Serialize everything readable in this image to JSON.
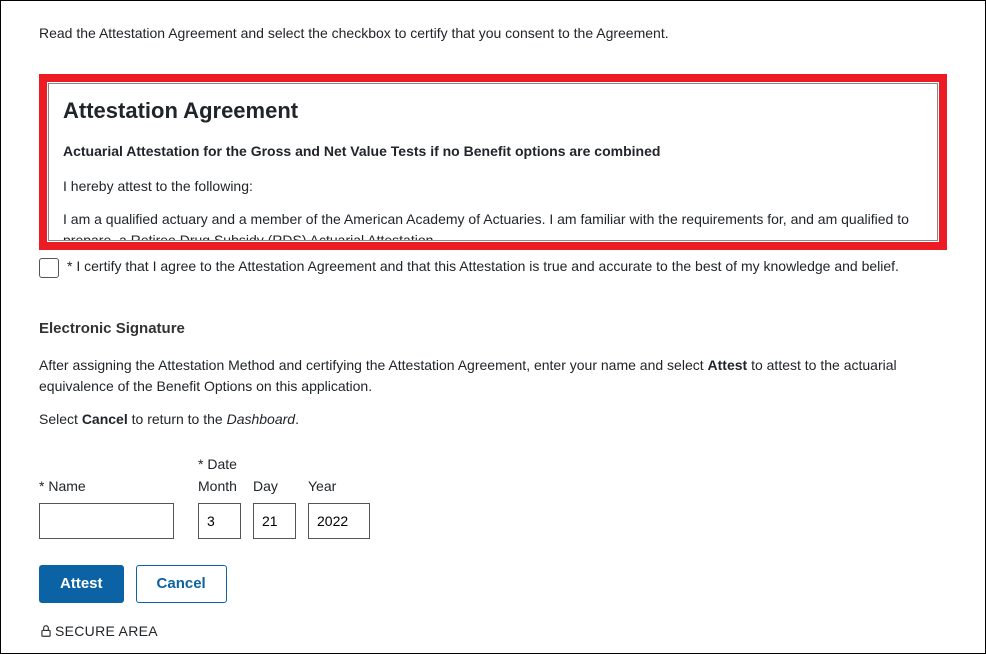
{
  "intro": "Read the Attestation Agreement and select the checkbox to certify that you consent to the Agreement.",
  "agreement": {
    "title": "Attestation Agreement",
    "subhead": "Actuarial Attestation for the Gross and Net Value Tests if no Benefit options are combined",
    "p1": "I hereby attest to the following:",
    "p2": "I am a qualified actuary and a member of the American Academy of Actuaries. I am familiar with the requirements for, and am qualified to prepare, a Retiree Drug Subsidy (RDS) Actuarial Attestation."
  },
  "certify_label": "* I certify that I agree to the Attestation Agreement and that this Attestation is true and accurate to the best of my knowledge and belief.",
  "signature": {
    "heading": "Electronic Signature",
    "p1_a": "After assigning the Attestation Method and certifying the Attestation Agreement, enter your name and select ",
    "p1_bold": "Attest",
    "p1_b": " to attest to the actuarial equivalence of the Benefit Options on this application.",
    "p2_a": "Select ",
    "p2_bold": "Cancel",
    "p2_b": " to return to the ",
    "p2_italic": "Dashboard",
    "p2_c": "."
  },
  "fields": {
    "name_label": "* Name",
    "date_label": "* Date",
    "month_label": "Month",
    "day_label": "Day",
    "year_label": "Year",
    "name_value": "",
    "month_value": "3",
    "day_value": "21",
    "year_value": "2022"
  },
  "buttons": {
    "attest": "Attest",
    "cancel": "Cancel"
  },
  "secure_area": "SECURE AREA"
}
